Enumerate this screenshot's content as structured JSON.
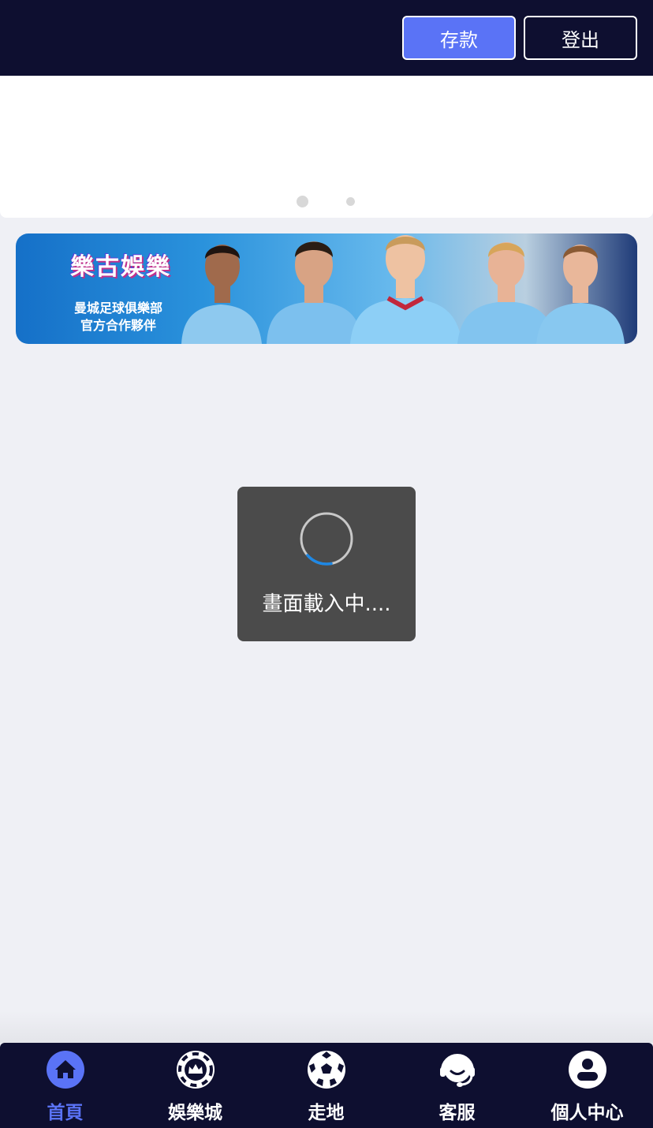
{
  "header": {
    "deposit_label": "存款",
    "logout_label": "登出"
  },
  "carousel": {
    "dots": 2,
    "active_index": 0
  },
  "banner": {
    "logo_text": "樂古娛樂",
    "subtitle_line1": "曼城足球俱樂部",
    "subtitle_line2": "官方合作夥伴"
  },
  "loading": {
    "text": "畫面載入中...."
  },
  "bottom_nav": {
    "items": [
      {
        "label": "首頁",
        "icon": "home-icon",
        "active": true
      },
      {
        "label": "娛樂城",
        "icon": "casino-chip-icon",
        "active": false
      },
      {
        "label": "走地",
        "icon": "soccer-ball-icon",
        "active": false
      },
      {
        "label": "客服",
        "icon": "headset-icon",
        "active": false
      },
      {
        "label": "個人中心",
        "icon": "user-icon",
        "active": false
      }
    ]
  },
  "colors": {
    "navy": "#0e0f30",
    "accent": "#5a73f6",
    "background": "#eff0f5",
    "toast": "#4b4b4b"
  }
}
